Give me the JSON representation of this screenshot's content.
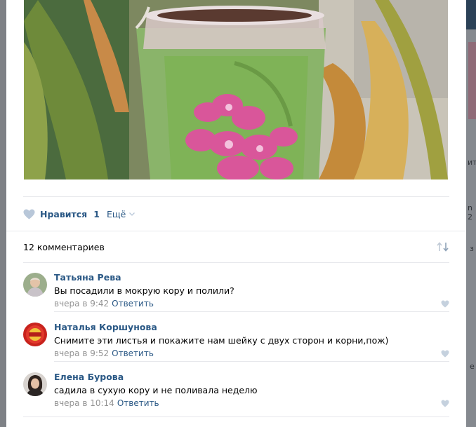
{
  "background_page": {
    "right_letters": [
      "ит",
      "n 2",
      "з",
      "е"
    ]
  },
  "actions": {
    "like_label": "Нравится",
    "like_count": "1",
    "more_label": "Ещё"
  },
  "comments_header": {
    "count_label": "12 комментариев"
  },
  "comments": [
    {
      "author": "Татьяна Рева",
      "text": "Вы посадили в мокрую кору и полили?",
      "time": "вчера в 9:42",
      "reply_label": "Ответить"
    },
    {
      "author": "Наталья Коршунова",
      "text": "Снимите эти листья и покажите нам шейку с двух сторон и корни,пож)",
      "time": "вчера в 9:52",
      "reply_label": "Ответить"
    },
    {
      "author": "Елена Бурова",
      "text": "садила в сухую кору и не поливала неделю",
      "time": "вчера в 10:14",
      "reply_label": "Ответить"
    }
  ],
  "colors": {
    "link": "#2a5885",
    "meta": "#939393",
    "heart_icon": "#b8c7d9",
    "separator": "#e7e8ec"
  }
}
